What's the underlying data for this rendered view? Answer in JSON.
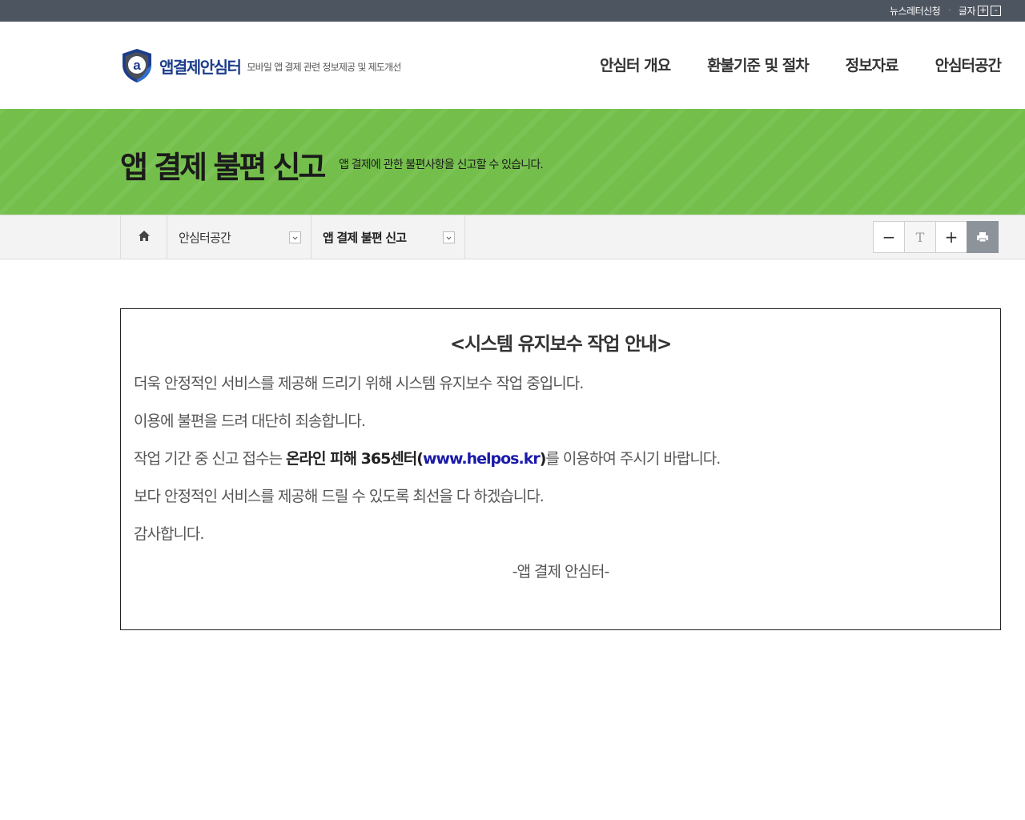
{
  "topbar": {
    "newsletter_label": "뉴스레터신청",
    "separator": "·",
    "font_size_label": "글자",
    "font_plus": "+",
    "font_minus": "-"
  },
  "header": {
    "logo_name": "앱결제안심터",
    "logo_tagline": "모바일 앱 결제 관련 정보제공 및 제도개선",
    "nav": [
      {
        "label": "안심터 개요"
      },
      {
        "label": "환불기준 및 절차"
      },
      {
        "label": "정보자료"
      },
      {
        "label": "안심터공간"
      }
    ]
  },
  "visual": {
    "title": "앱 결제 불편 신고",
    "subtitle": "앱 결제에 관한 불편사항을 신고할 수 있습니다."
  },
  "location": {
    "depth1": "안심터공간",
    "depth2": "앱 결제 불편 신고"
  },
  "tools": {
    "zoom_out": "−",
    "reset": "T",
    "zoom_in": "+"
  },
  "notice": {
    "title": "<시스템 유지보수 작업 안내>",
    "line1": "더욱 안정적인 서비스를 제공해 드리기 위해 시스템 유지보수 작업 중입니다.",
    "line2": "이용에 불편을 드려 대단히 죄송합니다.",
    "line3_pre": "작업 기간 중 신고 접수는 ",
    "line3_bold": "온라인 피해 365센터(",
    "line3_link": "www.helpos.kr",
    "line3_bold_end": ")",
    "line3_post": "를 이용하여 주시기 바랍니다.",
    "line4": "보다 안정적인 서비스를 제공해 드릴 수 있도록 최선을 다 하겠습니다.",
    "line5": "감사합니다.",
    "sign": "-앱 결제 안심터-"
  },
  "colors": {
    "topbar": "#4d5560",
    "brand_blue": "#1d3d8c",
    "visual_green": "#74bf4b",
    "link_blue": "#1a1aa8",
    "print_button": "#8d939a"
  }
}
